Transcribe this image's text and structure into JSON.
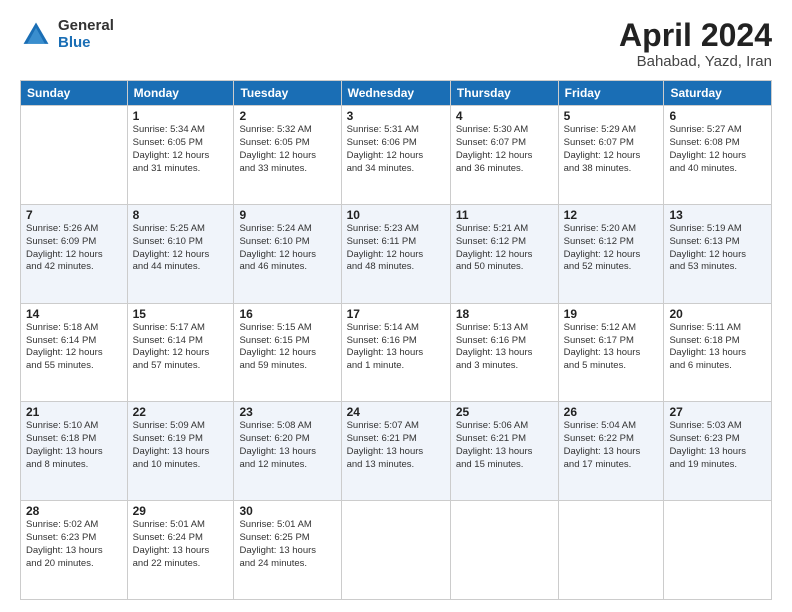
{
  "logo": {
    "general": "General",
    "blue": "Blue"
  },
  "title": "April 2024",
  "subtitle": "Bahabad, Yazd, Iran",
  "headers": [
    "Sunday",
    "Monday",
    "Tuesday",
    "Wednesday",
    "Thursday",
    "Friday",
    "Saturday"
  ],
  "weeks": [
    [
      {
        "num": "",
        "info": ""
      },
      {
        "num": "1",
        "info": "Sunrise: 5:34 AM\nSunset: 6:05 PM\nDaylight: 12 hours\nand 31 minutes."
      },
      {
        "num": "2",
        "info": "Sunrise: 5:32 AM\nSunset: 6:05 PM\nDaylight: 12 hours\nand 33 minutes."
      },
      {
        "num": "3",
        "info": "Sunrise: 5:31 AM\nSunset: 6:06 PM\nDaylight: 12 hours\nand 34 minutes."
      },
      {
        "num": "4",
        "info": "Sunrise: 5:30 AM\nSunset: 6:07 PM\nDaylight: 12 hours\nand 36 minutes."
      },
      {
        "num": "5",
        "info": "Sunrise: 5:29 AM\nSunset: 6:07 PM\nDaylight: 12 hours\nand 38 minutes."
      },
      {
        "num": "6",
        "info": "Sunrise: 5:27 AM\nSunset: 6:08 PM\nDaylight: 12 hours\nand 40 minutes."
      }
    ],
    [
      {
        "num": "7",
        "info": "Sunrise: 5:26 AM\nSunset: 6:09 PM\nDaylight: 12 hours\nand 42 minutes."
      },
      {
        "num": "8",
        "info": "Sunrise: 5:25 AM\nSunset: 6:10 PM\nDaylight: 12 hours\nand 44 minutes."
      },
      {
        "num": "9",
        "info": "Sunrise: 5:24 AM\nSunset: 6:10 PM\nDaylight: 12 hours\nand 46 minutes."
      },
      {
        "num": "10",
        "info": "Sunrise: 5:23 AM\nSunset: 6:11 PM\nDaylight: 12 hours\nand 48 minutes."
      },
      {
        "num": "11",
        "info": "Sunrise: 5:21 AM\nSunset: 6:12 PM\nDaylight: 12 hours\nand 50 minutes."
      },
      {
        "num": "12",
        "info": "Sunrise: 5:20 AM\nSunset: 6:12 PM\nDaylight: 12 hours\nand 52 minutes."
      },
      {
        "num": "13",
        "info": "Sunrise: 5:19 AM\nSunset: 6:13 PM\nDaylight: 12 hours\nand 53 minutes."
      }
    ],
    [
      {
        "num": "14",
        "info": "Sunrise: 5:18 AM\nSunset: 6:14 PM\nDaylight: 12 hours\nand 55 minutes."
      },
      {
        "num": "15",
        "info": "Sunrise: 5:17 AM\nSunset: 6:14 PM\nDaylight: 12 hours\nand 57 minutes."
      },
      {
        "num": "16",
        "info": "Sunrise: 5:15 AM\nSunset: 6:15 PM\nDaylight: 12 hours\nand 59 minutes."
      },
      {
        "num": "17",
        "info": "Sunrise: 5:14 AM\nSunset: 6:16 PM\nDaylight: 13 hours\nand 1 minute."
      },
      {
        "num": "18",
        "info": "Sunrise: 5:13 AM\nSunset: 6:16 PM\nDaylight: 13 hours\nand 3 minutes."
      },
      {
        "num": "19",
        "info": "Sunrise: 5:12 AM\nSunset: 6:17 PM\nDaylight: 13 hours\nand 5 minutes."
      },
      {
        "num": "20",
        "info": "Sunrise: 5:11 AM\nSunset: 6:18 PM\nDaylight: 13 hours\nand 6 minutes."
      }
    ],
    [
      {
        "num": "21",
        "info": "Sunrise: 5:10 AM\nSunset: 6:18 PM\nDaylight: 13 hours\nand 8 minutes."
      },
      {
        "num": "22",
        "info": "Sunrise: 5:09 AM\nSunset: 6:19 PM\nDaylight: 13 hours\nand 10 minutes."
      },
      {
        "num": "23",
        "info": "Sunrise: 5:08 AM\nSunset: 6:20 PM\nDaylight: 13 hours\nand 12 minutes."
      },
      {
        "num": "24",
        "info": "Sunrise: 5:07 AM\nSunset: 6:21 PM\nDaylight: 13 hours\nand 13 minutes."
      },
      {
        "num": "25",
        "info": "Sunrise: 5:06 AM\nSunset: 6:21 PM\nDaylight: 13 hours\nand 15 minutes."
      },
      {
        "num": "26",
        "info": "Sunrise: 5:04 AM\nSunset: 6:22 PM\nDaylight: 13 hours\nand 17 minutes."
      },
      {
        "num": "27",
        "info": "Sunrise: 5:03 AM\nSunset: 6:23 PM\nDaylight: 13 hours\nand 19 minutes."
      }
    ],
    [
      {
        "num": "28",
        "info": "Sunrise: 5:02 AM\nSunset: 6:23 PM\nDaylight: 13 hours\nand 20 minutes."
      },
      {
        "num": "29",
        "info": "Sunrise: 5:01 AM\nSunset: 6:24 PM\nDaylight: 13 hours\nand 22 minutes."
      },
      {
        "num": "30",
        "info": "Sunrise: 5:01 AM\nSunset: 6:25 PM\nDaylight: 13 hours\nand 24 minutes."
      },
      {
        "num": "",
        "info": ""
      },
      {
        "num": "",
        "info": ""
      },
      {
        "num": "",
        "info": ""
      },
      {
        "num": "",
        "info": ""
      }
    ]
  ]
}
